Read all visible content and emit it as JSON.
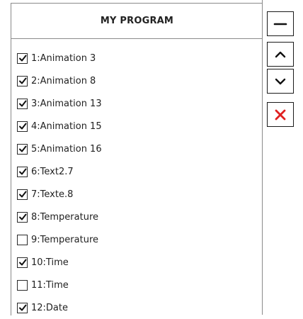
{
  "panel": {
    "title": "MY PROGRAM",
    "items": [
      {
        "label": "1:Animation 3",
        "checked": true
      },
      {
        "label": "2:Animation 8",
        "checked": true
      },
      {
        "label": "3:Animation 13",
        "checked": true
      },
      {
        "label": "4:Animation 15",
        "checked": true
      },
      {
        "label": "5:Animation 16",
        "checked": true
      },
      {
        "label": "6:Text2.7",
        "checked": true
      },
      {
        "label": "7:Texte.8",
        "checked": true
      },
      {
        "label": "8:Temperature",
        "checked": true
      },
      {
        "label": "9:Temperature",
        "checked": false
      },
      {
        "label": "10:Time",
        "checked": true
      },
      {
        "label": "11:Time",
        "checked": false
      },
      {
        "label": "12:Date",
        "checked": true
      }
    ]
  },
  "toolbar": {
    "buttons": [
      {
        "icon": "minus-icon"
      },
      {
        "icon": "chevron-up-icon"
      },
      {
        "icon": "chevron-down-icon"
      },
      {
        "icon": "close-icon",
        "color": "#e02020"
      }
    ]
  }
}
